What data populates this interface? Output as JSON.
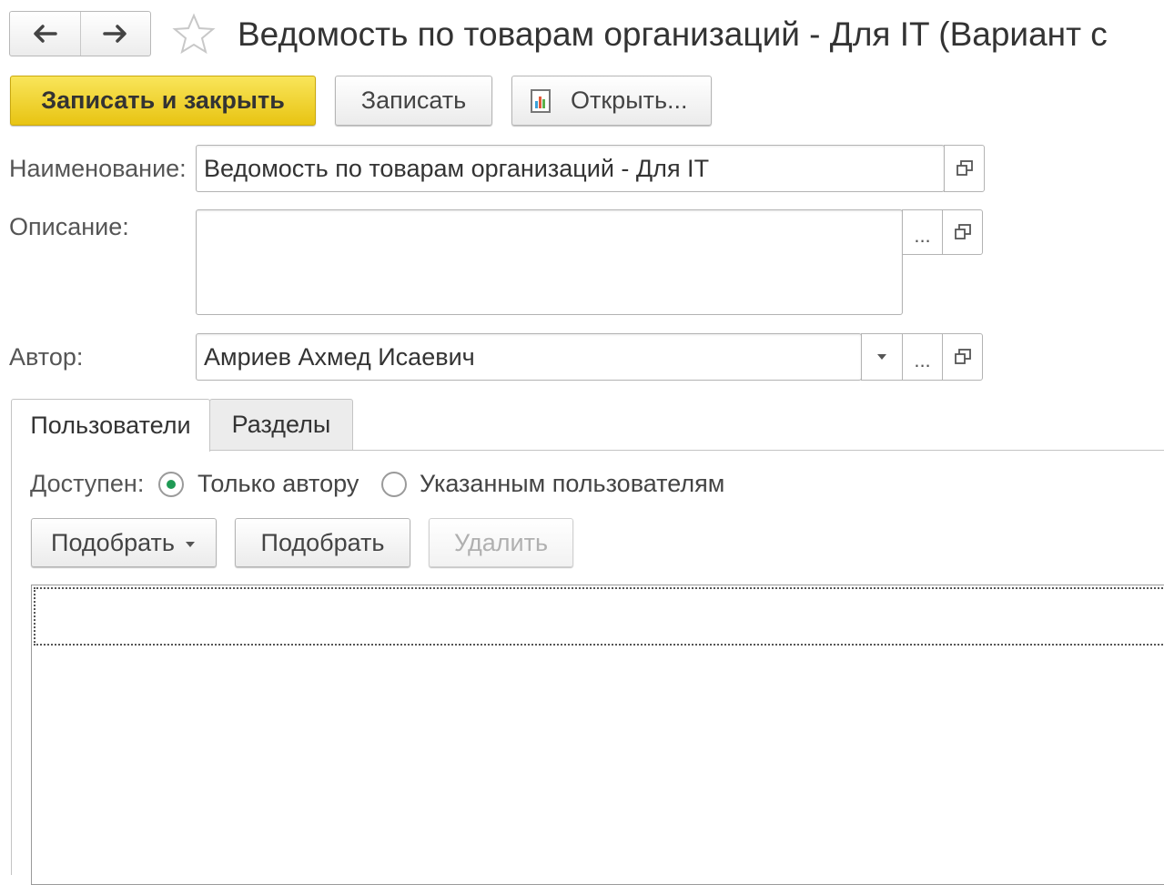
{
  "window": {
    "title": "Ведомость по товарам организаций - Для IT (Вариант с"
  },
  "nav": {
    "back_icon": "arrow-left-icon",
    "forward_icon": "arrow-right-icon",
    "favorite_icon": "star-outline-icon"
  },
  "toolbar": {
    "save_close_label": "Записать и закрыть",
    "save_label": "Записать",
    "open_label": "Открыть...",
    "open_icon": "report-icon"
  },
  "form": {
    "name_label": "Наименование:",
    "name_value": "Ведомость по товарам организаций - Для IT",
    "description_label": "Описание:",
    "description_value": "",
    "author_label": "Автор:",
    "author_value": "Амриев Ахмед Исаевич",
    "select_button_label": "..."
  },
  "tabs": [
    {
      "label": "Пользователи",
      "active": true
    },
    {
      "label": "Разделы",
      "active": false
    }
  ],
  "users_tab": {
    "available_label": "Доступен:",
    "radio_options": [
      {
        "label": "Только автору",
        "selected": true
      },
      {
        "label": "Указанным пользователям",
        "selected": false
      }
    ],
    "pick_dropdown_label": "Подобрать",
    "pick_label": "Подобрать",
    "delete_label": "Удалить"
  },
  "colors": {
    "primary_button": "#f3d632",
    "radio_selected": "#1f9a55"
  }
}
